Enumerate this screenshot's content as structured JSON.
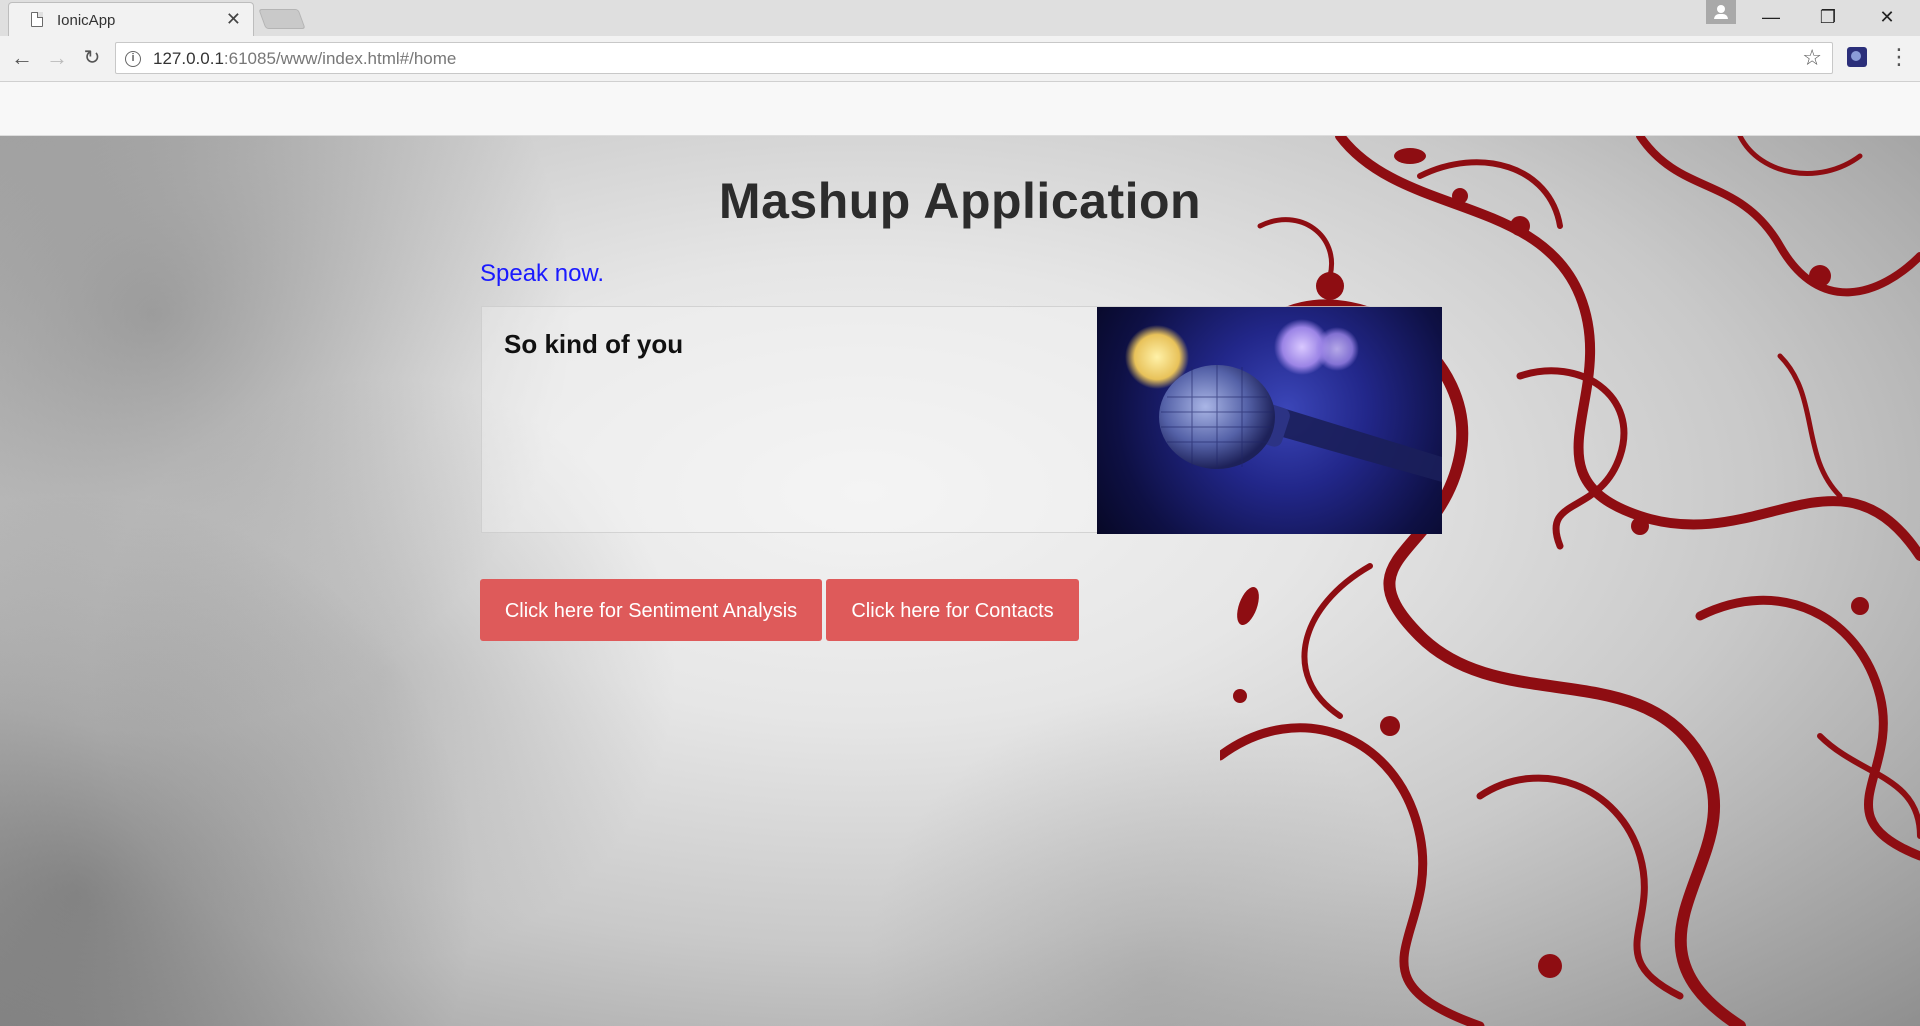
{
  "browser": {
    "tab_title": "IonicApp",
    "tab_close": "✕",
    "url_host": "127.0.0.1",
    "url_rest": ":61085/www/index.html#/home",
    "window_min": "—",
    "window_max": "❐",
    "window_close": "✕",
    "back": "←",
    "forward": "→",
    "reload": "↻",
    "star": "☆",
    "menu": "⋮"
  },
  "app": {
    "title": "Mashup Application",
    "speak_prompt": "Speak now.",
    "transcript": "So kind of you",
    "buttons": {
      "sentiment": "Click here for Sentiment Analysis",
      "contacts": "Click here for Contacts"
    },
    "image": "microphone-image",
    "colors": {
      "button_bg": "#de5a5a",
      "speak_text": "#1a1aff",
      "swirl": "#8e0d12"
    }
  }
}
